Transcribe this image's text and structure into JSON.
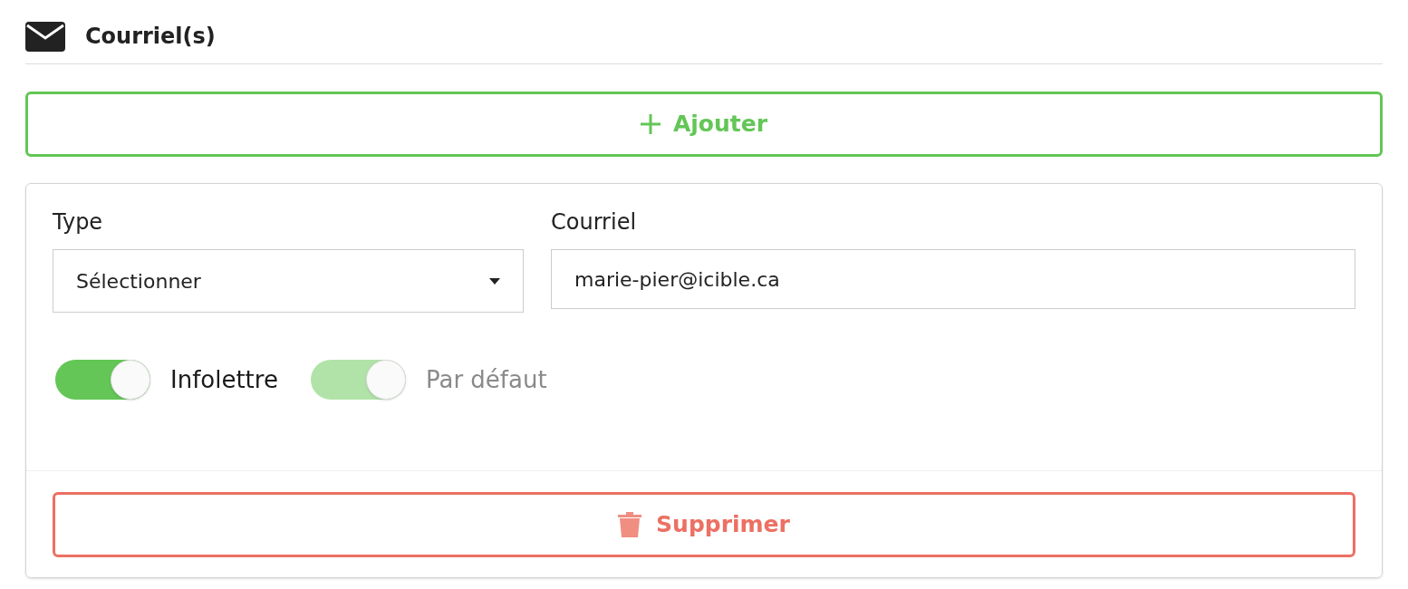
{
  "section": {
    "title": "Courriel(s)"
  },
  "add_button": {
    "label": "Ajouter"
  },
  "entry": {
    "type_field": {
      "label": "Type",
      "value": "Sélectionner"
    },
    "email_field": {
      "label": "Courriel",
      "value": "marie-pier@icible.ca"
    },
    "toggles": [
      {
        "label": "Infolettre",
        "on": true,
        "disabled": false
      },
      {
        "label": "Par défaut",
        "on": true,
        "disabled": true
      }
    ],
    "delete_button": {
      "label": "Supprimer"
    }
  }
}
